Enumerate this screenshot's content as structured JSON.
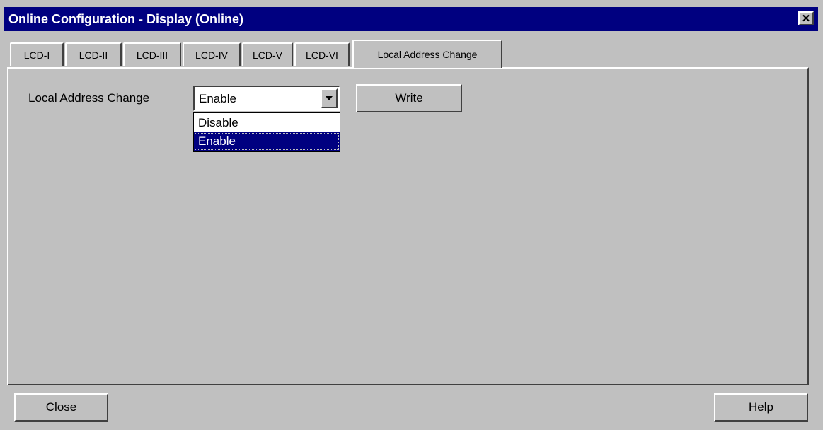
{
  "window": {
    "title": "Online Configuration - Display  (Online)",
    "close_glyph": "✕",
    "close_icon": "close-icon"
  },
  "tabs": [
    {
      "label": "LCD-I"
    },
    {
      "label": "LCD-II"
    },
    {
      "label": "LCD-III"
    },
    {
      "label": "LCD-IV"
    },
    {
      "label": "LCD-V"
    },
    {
      "label": "LCD-VI"
    },
    {
      "label": "Local Address Change",
      "active": true
    }
  ],
  "panel": {
    "local_address_change_label": "Local Address Change",
    "select": {
      "value": "Enable",
      "options": [
        "Disable",
        "Enable"
      ],
      "highlighted": "Enable",
      "arrow_icon": "chevron-down-icon"
    },
    "write_label": "Write"
  },
  "footer": {
    "close_label": "Close",
    "help_label": "Help"
  },
  "colors": {
    "titlebar": "#000080",
    "face": "#c0c0c0",
    "highlight": "#000080"
  }
}
